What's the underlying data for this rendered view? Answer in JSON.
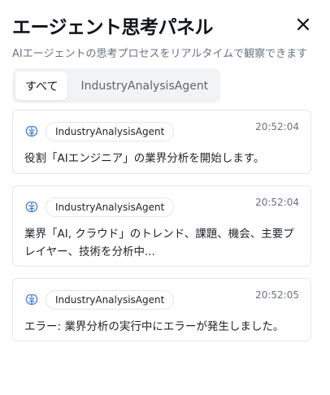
{
  "panel": {
    "title": "エージェント思考パネル",
    "subtitle": "AIエージェントの思考プロセスをリアルタイムで観察できます"
  },
  "tabs": [
    {
      "label": "すべて",
      "active": true
    },
    {
      "label": "IndustryAnalysisAgent",
      "active": false
    }
  ],
  "entries": [
    {
      "agent": "IndustryAnalysisAgent",
      "time": "20:52:04",
      "message": "役割「AIエンジニア」の業界分析を開始します。"
    },
    {
      "agent": "IndustryAnalysisAgent",
      "time": "20:52:04",
      "message": "業界「AI, クラウド」のトレンド、課題、機会、主要プレイヤー、技術を分析中..."
    },
    {
      "agent": "IndustryAnalysisAgent",
      "time": "20:52:05",
      "message": "エラー: 業界分析の実行中にエラーが発生しました。"
    }
  ],
  "colors": {
    "brain_icon": "#3a7bd5",
    "border": "#e3e6ea",
    "muted_text": "#6b7280"
  },
  "icons": {
    "close": "close-icon",
    "agent": "brain-icon"
  }
}
